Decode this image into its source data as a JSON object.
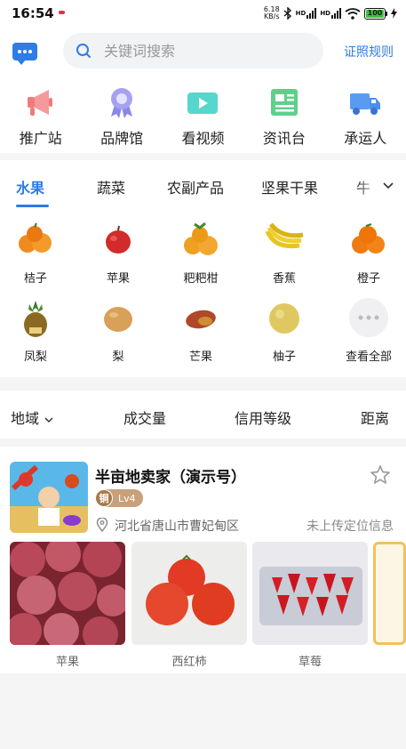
{
  "status_bar": {
    "time": "16:54",
    "net_speed_value": "6.18",
    "net_speed_unit": "KB/s",
    "hd1": "HD",
    "hd2": "HD",
    "battery_level": "100"
  },
  "header": {
    "search_placeholder": "关键词搜索",
    "rules_link": "证照规则"
  },
  "quick_nav": [
    {
      "label": "推广站",
      "icon": "megaphone-icon",
      "color": "#f07a7a"
    },
    {
      "label": "品牌馆",
      "icon": "award-ribbon-icon",
      "color": "#8b86e8"
    },
    {
      "label": "看视频",
      "icon": "video-camera-icon",
      "color": "#3cc8c0"
    },
    {
      "label": "资讯台",
      "icon": "newspaper-icon",
      "color": "#4cc47a"
    },
    {
      "label": "承运人",
      "icon": "truck-icon",
      "color": "#4a8ef0"
    }
  ],
  "categories": {
    "tabs": [
      "水果",
      "蔬菜",
      "农副产品",
      "坚果干果",
      "牛"
    ],
    "active": "水果",
    "items": [
      {
        "label": "桔子"
      },
      {
        "label": "苹果"
      },
      {
        "label": "粑粑柑"
      },
      {
        "label": "香蕉"
      },
      {
        "label": "橙子"
      },
      {
        "label": "凤梨"
      },
      {
        "label": "梨"
      },
      {
        "label": "芒果"
      },
      {
        "label": "柚子"
      },
      {
        "label": "查看全部"
      }
    ]
  },
  "filters": [
    "地域",
    "成交量",
    "信用等级",
    "距离"
  ],
  "shop": {
    "name": "半亩地卖家（演示号）",
    "level_seal": "铜",
    "level": "Lv4",
    "location": "河北省唐山市曹妃甸区",
    "location_status": "未上传定位信息",
    "products": [
      {
        "label": "苹果"
      },
      {
        "label": "西红柿"
      },
      {
        "label": "草莓"
      }
    ]
  },
  "colors": {
    "accent": "#2d7ce8",
    "badge": "#c8a07a"
  }
}
